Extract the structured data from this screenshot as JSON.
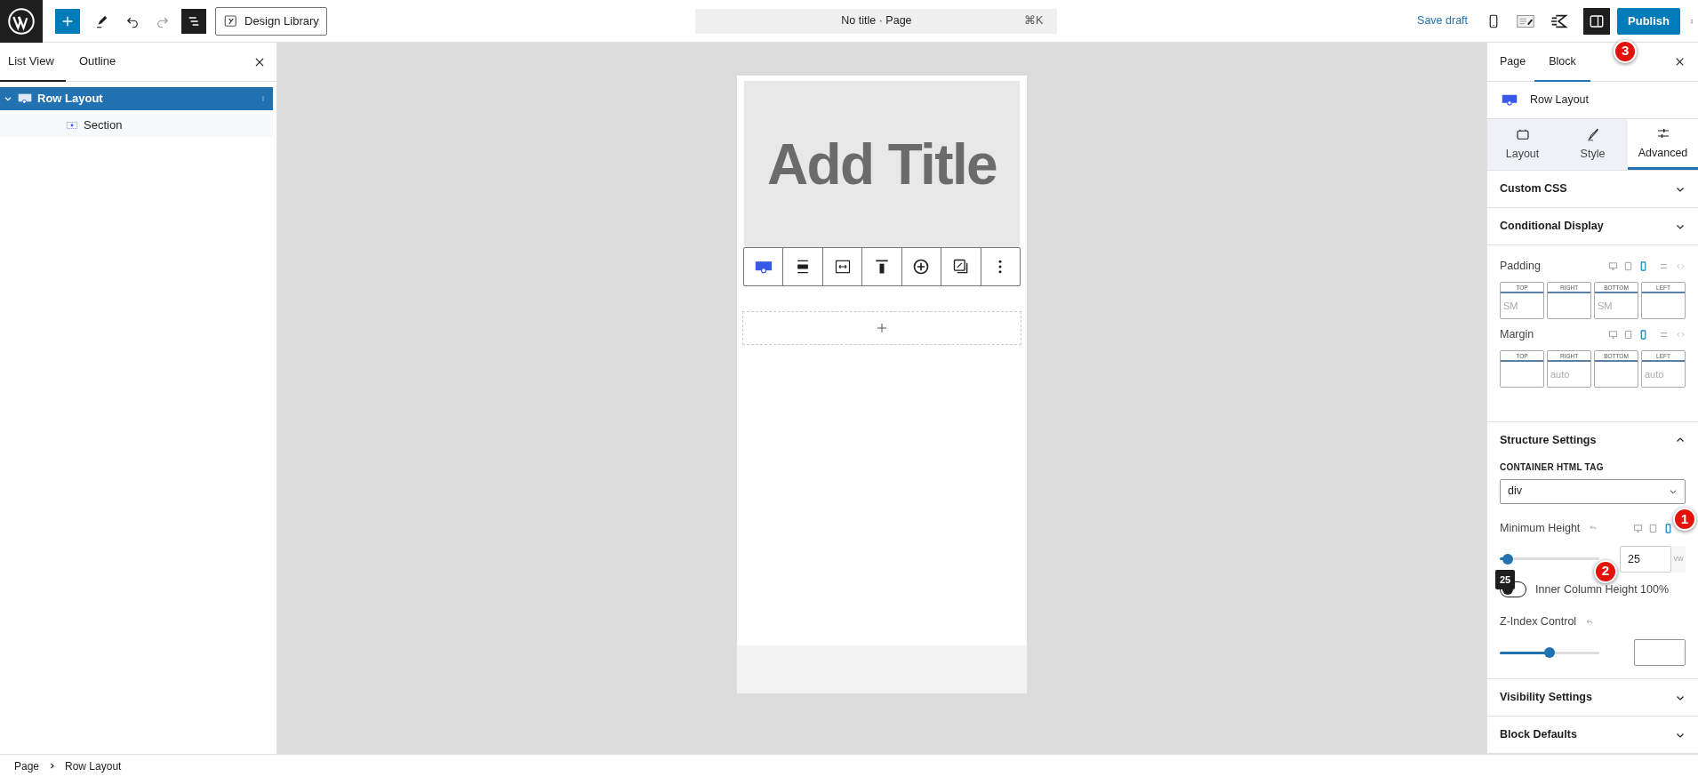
{
  "topbar": {
    "design_library": "Design Library",
    "command": {
      "title": "No title · Page",
      "shortcut": "⌘K"
    },
    "save_draft": "Save draft",
    "sidebar_open": true,
    "publish": "Publish",
    "publish_callout": "3"
  },
  "list_panel": {
    "tabs": [
      {
        "label": "List View",
        "selected": true
      },
      {
        "label": "Outline",
        "selected": false
      }
    ],
    "items": [
      {
        "label": "Row Layout",
        "selected": true,
        "expanded": true,
        "children": [
          {
            "label": "Section",
            "selected": false
          }
        ]
      }
    ]
  },
  "canvas": {
    "title": "Add Title"
  },
  "sidebar": {
    "tabs": [
      {
        "label": "Page",
        "selected": false
      },
      {
        "label": "Block",
        "selected": true
      }
    ],
    "block_name": "Row Layout",
    "sub_tabs": [
      {
        "label": "Layout",
        "kind": "layout",
        "selected": false
      },
      {
        "label": "Style",
        "kind": "style",
        "selected": false
      },
      {
        "label": "Advanced",
        "kind": "advanced",
        "selected": true
      }
    ],
    "panels": [
      {
        "kind": "section",
        "label": "Custom CSS",
        "expanded": false
      },
      {
        "kind": "section",
        "label": "Conditional Display",
        "expanded": false
      },
      {
        "kind": "spacing",
        "groups": [
          {
            "label": "Padding",
            "devices": [
              {
                "kind": "desktop",
                "selected": false
              },
              {
                "kind": "tablet",
                "selected": false
              },
              {
                "kind": "mobile",
                "selected": true
              }
            ],
            "sides": [
              {
                "label": "TOP",
                "placeholder": "SM"
              },
              {
                "label": "RIGHT"
              },
              {
                "label": "BOTTOM",
                "placeholder": "SM"
              },
              {
                "label": "LEFT"
              }
            ]
          },
          {
            "label": "Margin",
            "devices": [
              {
                "kind": "desktop",
                "selected": false
              },
              {
                "kind": "tablet",
                "selected": false
              },
              {
                "kind": "mobile",
                "selected": true
              }
            ],
            "sides": [
              {
                "label": "TOP"
              },
              {
                "label": "RIGHT",
                "placeholder": "auto"
              },
              {
                "label": "BOTTOM"
              },
              {
                "label": "LEFT",
                "placeholder": "auto"
              }
            ]
          }
        ]
      },
      {
        "kind": "section",
        "label": "Structure Settings",
        "expanded": true,
        "fields": [
          {
            "kind": "select",
            "label": "CONTAINER HTML TAG",
            "value": "div"
          },
          {
            "kind": "range",
            "label": "Minimum Height",
            "level": 0.08,
            "value": "25",
            "unit": "vw",
            "tooltip": "25",
            "devices": [
              {
                "kind": "desktop",
                "selected": false
              },
              {
                "kind": "tablet",
                "selected": false
              },
              {
                "kind": "mobile",
                "selected": true
              }
            ],
            "device_callout": "1",
            "value_callout": "2"
          },
          {
            "kind": "toggle",
            "label": "Inner Column Height 100%",
            "checked": false
          },
          {
            "kind": "range",
            "label": "Z-Index Control",
            "level": 0.5
          }
        ]
      },
      {
        "kind": "section",
        "label": "Visibility Settings",
        "expanded": false
      },
      {
        "kind": "section",
        "label": "Block Defaults",
        "expanded": false
      }
    ]
  },
  "breadcrumb": [
    "Page",
    "Row Layout"
  ]
}
